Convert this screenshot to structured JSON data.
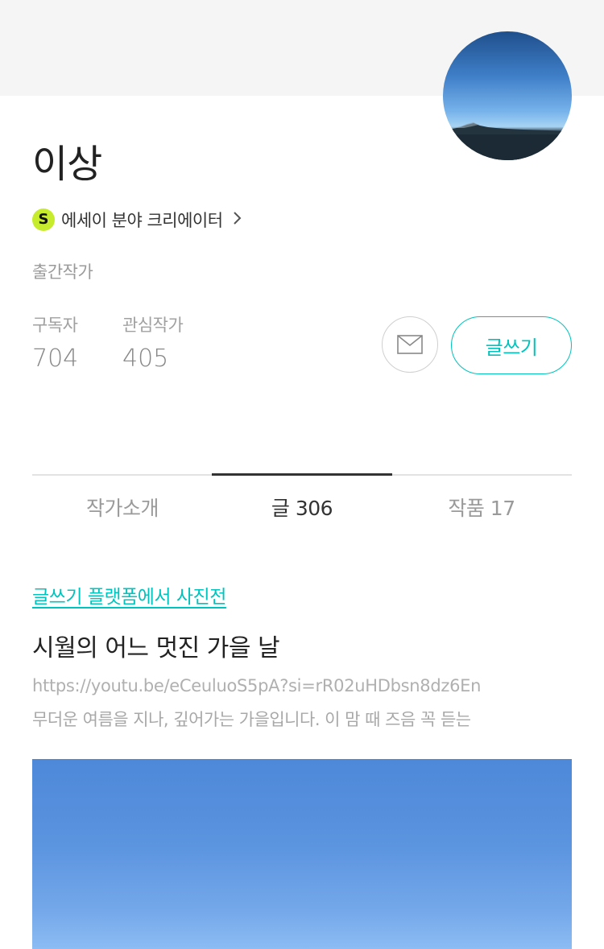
{
  "profile": {
    "name": "이상",
    "creator_badge": "S",
    "creator_label": "에세이 분야 크리에이터",
    "job": "출간작가",
    "stats": {
      "subscribers_label": "구독자",
      "subscribers_value": "704",
      "following_label": "관심작가",
      "following_value": "405"
    },
    "write_button_label": "글쓰기"
  },
  "tabs": [
    {
      "label": "작가소개"
    },
    {
      "label": "글 306",
      "active": true
    },
    {
      "label": "작품 17"
    }
  ],
  "post": {
    "tag": "글쓰기 플랫폼에서 사진전",
    "title": "시월의 어느 멋진 가을 날",
    "url": "https://youtu.be/eCeuluoS5pA?si=rR02uHDbsn8dz6En",
    "excerpt": "무더운 여름을 지나, 깊어가는 가을입니다.  이 맘 때 즈음 꼭 듣는"
  },
  "colors": {
    "accent": "#00c3bd",
    "badge": "#c6ec2d"
  },
  "icons": {
    "mail": "envelope-icon",
    "chevron": "chevron-right-icon"
  }
}
